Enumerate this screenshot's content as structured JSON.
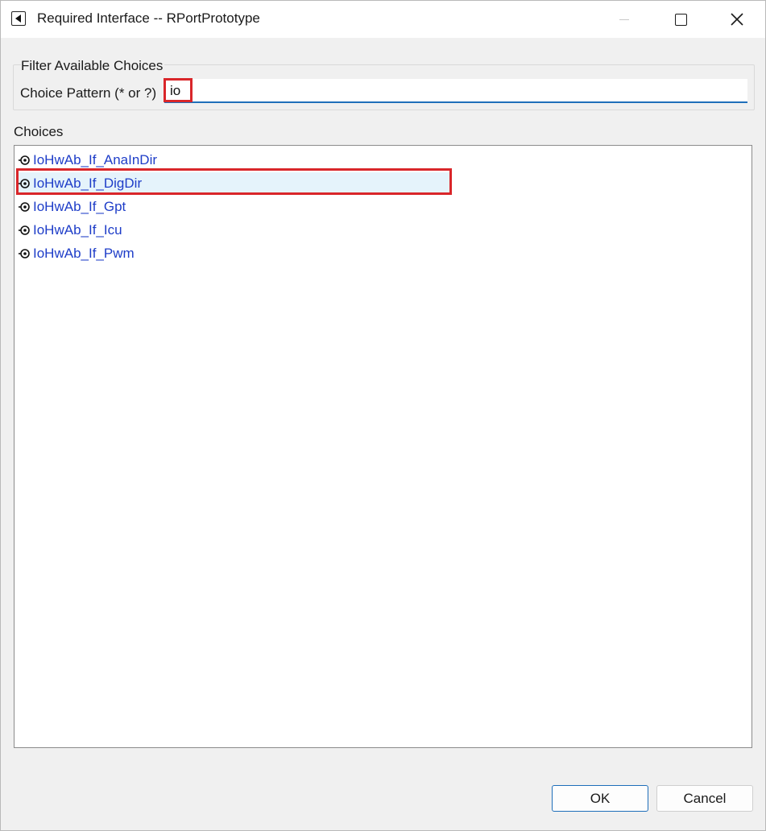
{
  "window": {
    "title": "Required Interface -- RPortPrototype"
  },
  "filter": {
    "legend": "Filter Available Choices",
    "pattern_label": "Choice Pattern (* or ?)",
    "pattern_value": "io"
  },
  "choices": {
    "label": "Choices",
    "items": [
      {
        "label": "IoHwAb_If_AnaInDir",
        "icon": "interface-port-icon"
      },
      {
        "label": "IoHwAb_If_DigDir",
        "icon": "interface-port-icon",
        "selected": true
      },
      {
        "label": "IoHwAb_If_Gpt",
        "icon": "interface-port-icon"
      },
      {
        "label": "IoHwAb_If_Icu",
        "icon": "interface-port-icon"
      },
      {
        "label": "IoHwAb_If_Pwm",
        "icon": "interface-port-icon"
      }
    ]
  },
  "buttons": {
    "ok": "OK",
    "cancel": "Cancel"
  },
  "colors": {
    "accent": "#1f6fba",
    "item_text": "#1e3dc8",
    "selection_bg": "#e5f3fb",
    "annotation": "#d9262a"
  }
}
